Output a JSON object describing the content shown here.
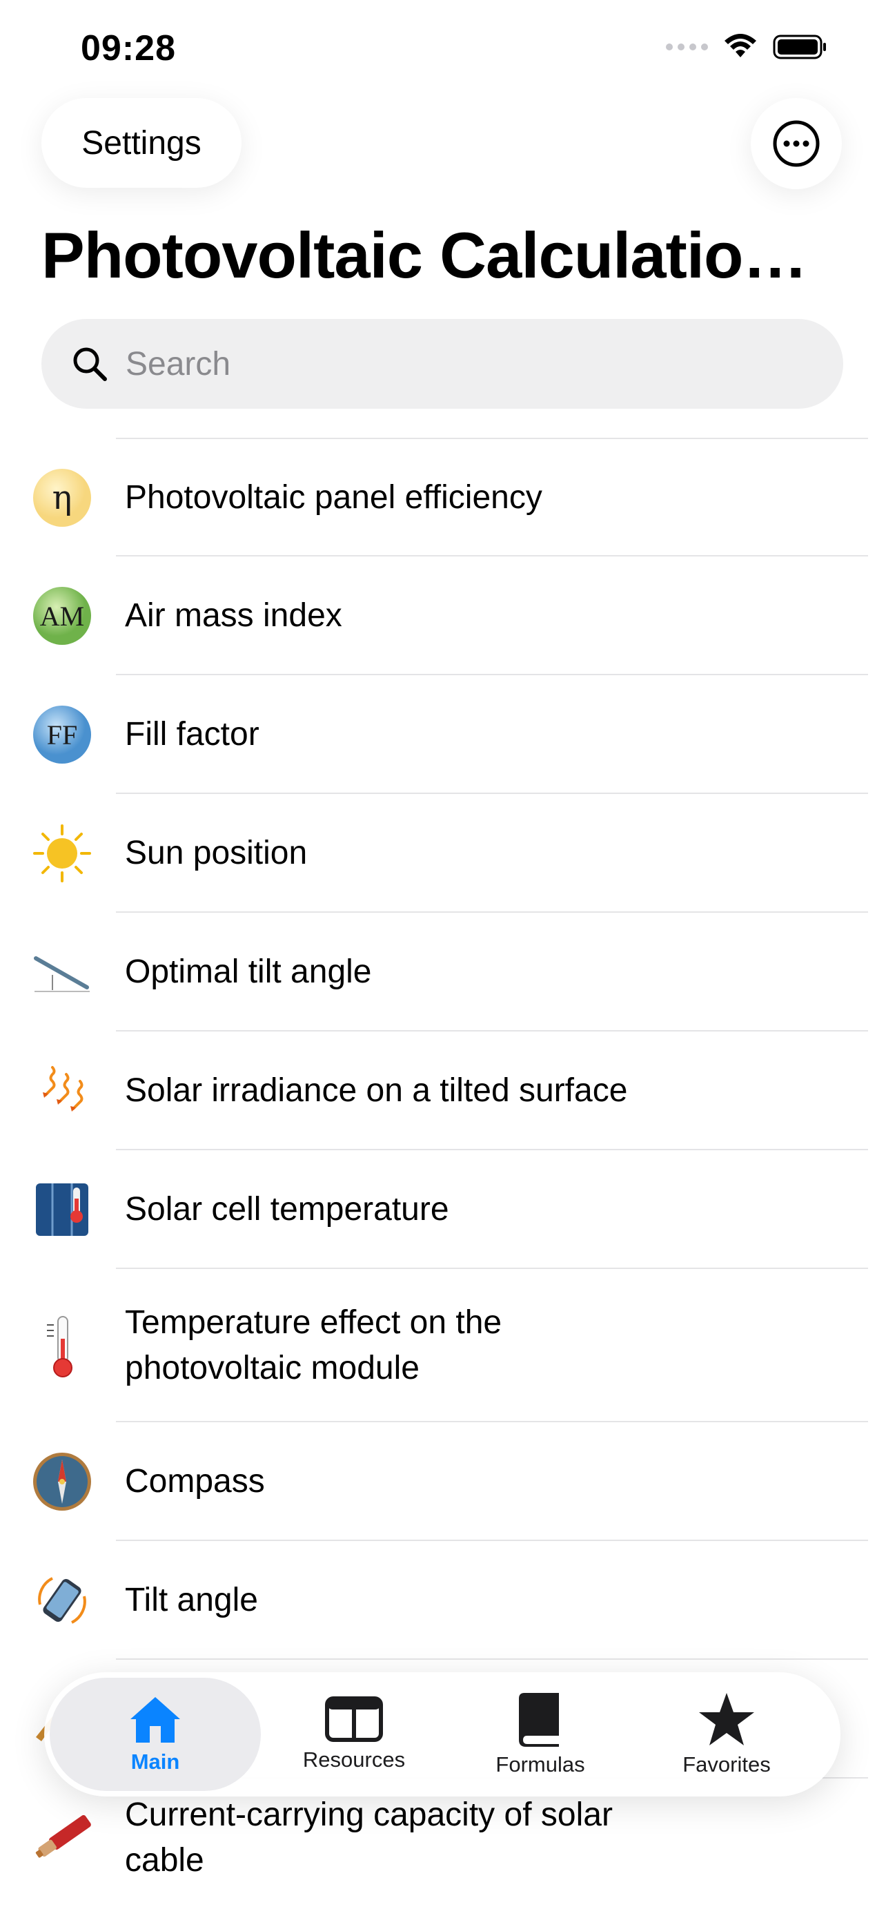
{
  "status_bar": {
    "time": "09:28"
  },
  "header": {
    "settings_label": "Settings",
    "title": "Photovoltaic Calculatio…"
  },
  "search": {
    "placeholder": "Search",
    "value": ""
  },
  "items": [
    {
      "label": "Photovoltaic panel efficiency",
      "icon": "eta-icon"
    },
    {
      "label": "Air mass index",
      "icon": "air-mass-icon"
    },
    {
      "label": "Fill factor",
      "icon": "fill-factor-icon"
    },
    {
      "label": "Sun position",
      "icon": "sun-icon"
    },
    {
      "label": "Optimal tilt angle",
      "icon": "tilt-panel-icon"
    },
    {
      "label": "Solar irradiance on a tilted surface",
      "icon": "irradiance-icon"
    },
    {
      "label": "Solar cell temperature",
      "icon": "solar-cell-thermometer-icon"
    },
    {
      "label": "Temperature effect on the photovoltaic module",
      "icon": "thermometer-icon"
    },
    {
      "label": "Compass",
      "icon": "compass-icon"
    },
    {
      "label": "Tilt angle",
      "icon": "phone-rotate-icon"
    },
    {
      "label": "",
      "icon": "partially-hidden-icon"
    },
    {
      "label": "Current-carrying capacity of solar cable",
      "icon": "solar-cable-icon"
    }
  ],
  "icon_texts": {
    "eta": "η",
    "air_mass": "AM",
    "fill_factor": "FF"
  },
  "tabs": [
    {
      "label": "Main",
      "icon": "house-icon",
      "active": true
    },
    {
      "label": "Resources",
      "icon": "layout-icon",
      "active": false
    },
    {
      "label": "Formulas",
      "icon": "book-icon",
      "active": false
    },
    {
      "label": "Favorites",
      "icon": "star-icon",
      "active": false
    }
  ],
  "colors": {
    "accent": "#0a84ff",
    "separator": "#e4e4e6",
    "search_bg": "#efeff0"
  }
}
